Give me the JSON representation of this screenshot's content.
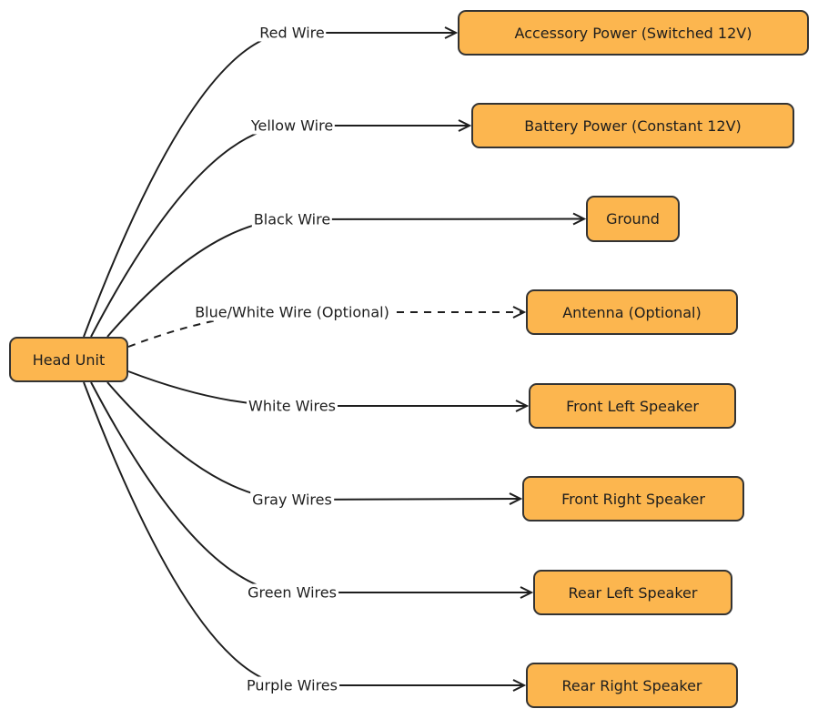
{
  "colors": {
    "node_fill": "#fcb64f",
    "stroke": "#1e1e1e"
  },
  "source": {
    "id": "head",
    "label": "Head Unit"
  },
  "edges": [
    {
      "label": "Red Wire",
      "target": "Accessory Power (Switched 12V)",
      "style": "solid"
    },
    {
      "label": "Yellow Wire",
      "target": "Battery Power (Constant 12V)",
      "style": "solid"
    },
    {
      "label": "Black Wire",
      "target": "Ground",
      "style": "solid"
    },
    {
      "label": "Blue/White Wire (Optional)",
      "target": "Antenna (Optional)",
      "style": "dashed"
    },
    {
      "label": "White Wires",
      "target": "Front Left Speaker",
      "style": "solid"
    },
    {
      "label": "Gray Wires",
      "target": "Front Right Speaker",
      "style": "solid"
    },
    {
      "label": "Green Wires",
      "target": "Rear Left Speaker",
      "style": "solid"
    },
    {
      "label": "Purple Wires",
      "target": "Rear Right Speaker",
      "style": "solid"
    }
  ]
}
